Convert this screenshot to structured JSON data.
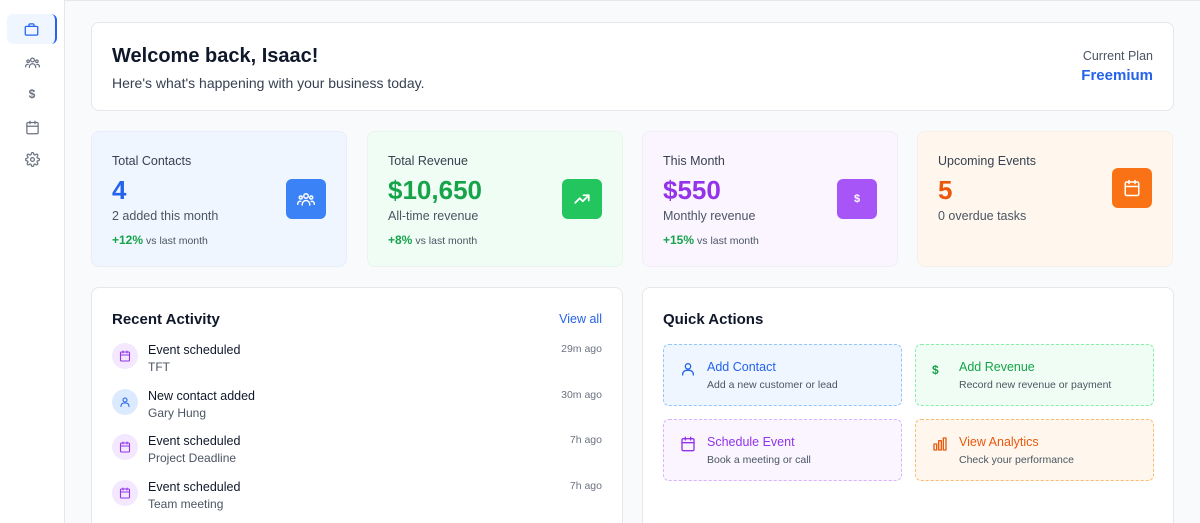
{
  "sidebar": {
    "items": [
      {
        "icon": "briefcase-icon",
        "active": true
      },
      {
        "icon": "users-icon"
      },
      {
        "icon": "dollar-icon",
        "glyph": "$"
      },
      {
        "icon": "calendar-icon"
      },
      {
        "icon": "gear-icon"
      }
    ]
  },
  "welcome": {
    "title": "Welcome back, Isaac!",
    "subtitle": "Here's what's happening with your business today.",
    "plan_label": "Current Plan",
    "plan_value": "Freemium"
  },
  "stats": [
    {
      "label": "Total Contacts",
      "value": "4",
      "note": "2 added this month",
      "trend": "+12%",
      "trend_rest": "vs last month",
      "icon": "users-icon",
      "accent": "#3b82f6"
    },
    {
      "label": "Total Revenue",
      "value": "$10,650",
      "note": "All-time revenue",
      "trend": "+8%",
      "trend_rest": "vs last month",
      "icon": "trending-up-icon",
      "accent": "#22c55e"
    },
    {
      "label": "This Month",
      "value": "$550",
      "note": "Monthly revenue",
      "trend": "+15%",
      "trend_rest": "vs last month",
      "icon": "dollar-icon",
      "glyph": "$",
      "accent": "#a855f7"
    },
    {
      "label": "Upcoming Events",
      "value": "5",
      "note": "0 overdue tasks",
      "icon": "calendar-icon",
      "accent": "#f97316"
    }
  ],
  "activity": {
    "title": "Recent Activity",
    "view_all": "View all",
    "items": [
      {
        "type": "event",
        "icon": "calendar-icon",
        "title": "Event scheduled",
        "subtitle": "TFT",
        "time": "29m ago"
      },
      {
        "type": "contact",
        "icon": "user-icon",
        "title": "New contact added",
        "subtitle": "Gary Hung",
        "time": "30m ago"
      },
      {
        "type": "event",
        "icon": "calendar-icon",
        "title": "Event scheduled",
        "subtitle": "Project Deadline",
        "time": "7h ago"
      },
      {
        "type": "event",
        "icon": "calendar-icon",
        "title": "Event scheduled",
        "subtitle": "Team meeting",
        "time": "7h ago"
      }
    ]
  },
  "quick_actions": {
    "title": "Quick Actions",
    "items": [
      {
        "title": "Add Contact",
        "subtitle": "Add a new customer or lead",
        "icon": "user-icon"
      },
      {
        "title": "Add Revenue",
        "subtitle": "Record new revenue or payment",
        "icon": "dollar-icon",
        "glyph": "$"
      },
      {
        "title": "Schedule Event",
        "subtitle": "Book a meeting or call",
        "icon": "calendar-icon"
      },
      {
        "title": "View Analytics",
        "subtitle": "Check your performance",
        "icon": "bar-chart-icon"
      }
    ]
  }
}
